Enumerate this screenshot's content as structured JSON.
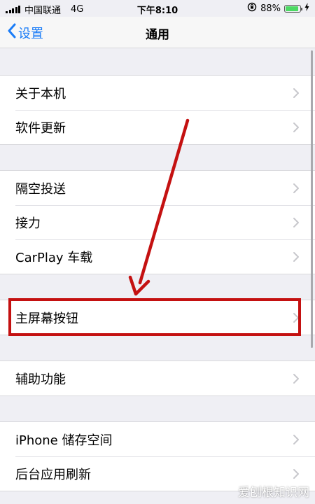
{
  "status_bar": {
    "carrier": "中国联通",
    "network": "4G",
    "time": "下午8:10",
    "battery_percent": "88%",
    "battery_level": 0.88
  },
  "nav": {
    "back_label": "设置",
    "title": "通用"
  },
  "groups": [
    {
      "items": [
        "关于本机",
        "软件更新"
      ]
    },
    {
      "items": [
        "隔空投送",
        "接力",
        "CarPlay 车载"
      ]
    },
    {
      "items": [
        "主屏幕按钮"
      ]
    },
    {
      "items": [
        "辅助功能"
      ]
    },
    {
      "items": [
        "iPhone 储存空间",
        "后台应用刷新"
      ]
    }
  ],
  "watermark": "爱刨根知识网",
  "colors": {
    "accent": "#1a7cf7",
    "annotation": "#c41111",
    "background": "#efeff4"
  }
}
